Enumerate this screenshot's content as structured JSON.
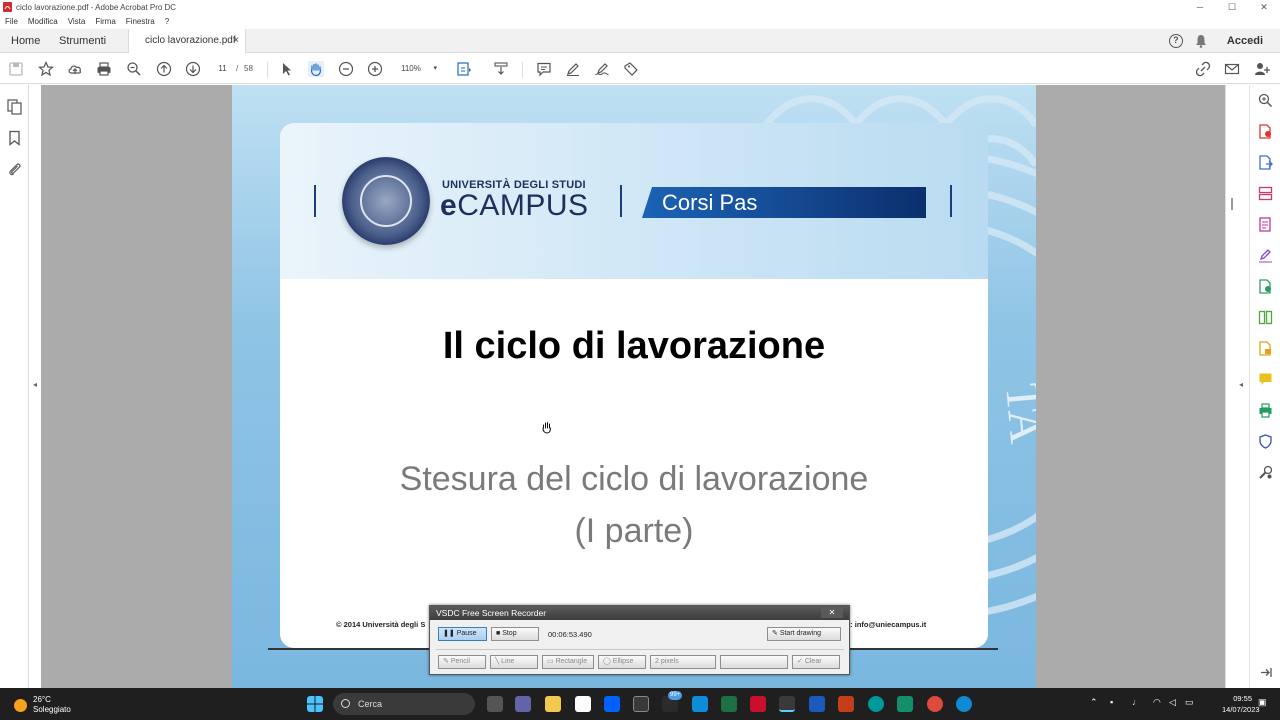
{
  "window": {
    "title": "ciclo lavorazione.pdf - Adobe Acrobat Pro DC",
    "controls": [
      "─",
      "☐",
      "✕"
    ]
  },
  "menu": [
    "File",
    "Modifica",
    "Vista",
    "Firma",
    "Finestra",
    "?"
  ],
  "tabs": {
    "home": "Home",
    "tools": "Strumenti",
    "doc": "ciclo lavorazione.pdf",
    "close": "×"
  },
  "header_right": {
    "help": "?",
    "signin": "Accedi"
  },
  "toolbar": {
    "page_current": "11",
    "page_sep": "/",
    "page_total": "58",
    "zoom": "110%",
    "zoom_chevron": "▾"
  },
  "slide": {
    "university_line": "UNIVERSITÀ DEGLI STUDI",
    "brand_e": "e",
    "brand_rest": "CAMPUS",
    "banner": "Corsi Pas",
    "title": "Il ciclo di lavorazione",
    "subtitle_line1": "Stesura del ciclo di lavorazione",
    "subtitle_line2": "(I parte)",
    "footer_left": "© 2014 Università degli S",
    "footer_right": "il: info@uniecampus.it"
  },
  "recorder": {
    "title": "VSDC Free Screen Recorder",
    "close": "✕",
    "pause": "Pause",
    "stop": "Stop",
    "elapsed": "00:06:53.490",
    "start_drawing": "Start drawing",
    "pencil": "Pencil",
    "line": "Line",
    "rectangle": "Rectangle",
    "ellipse": "Ellipse",
    "width": "2 pixels",
    "clear": "Clear"
  },
  "taskbar": {
    "temperature": "26°C",
    "weather": "Soleggiato",
    "search": "Cerca",
    "badge": "99+",
    "time": "09:55",
    "date": "14/07/2023"
  },
  "colors": {
    "slide_banner": "#154b94",
    "slide_background": "#8fc4e5",
    "doc_background": "#ababab",
    "taskbar": "#1f1f1f"
  }
}
